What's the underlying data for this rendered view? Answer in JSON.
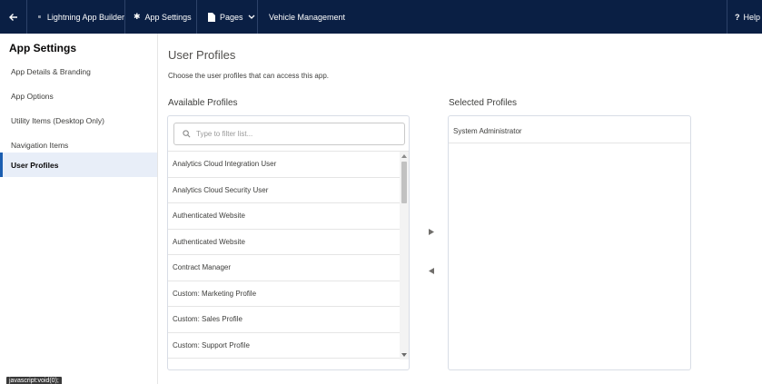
{
  "topbar": {
    "back_icon": "arrow-left-icon",
    "builder_label": "Lightning App Builder",
    "settings_label": "App Settings",
    "pages_label": "Pages",
    "app_name": "Vehicle Management",
    "help_label": "Help",
    "background_color": "#0a1f44"
  },
  "sidebar": {
    "title": "App Settings",
    "items": [
      {
        "label": "App Details & Branding",
        "active": false
      },
      {
        "label": "App Options",
        "active": false
      },
      {
        "label": "Utility Items (Desktop Only)",
        "active": false
      },
      {
        "label": "Navigation Items",
        "active": false
      },
      {
        "label": "User Profiles",
        "active": true
      }
    ]
  },
  "main": {
    "title": "User Profiles",
    "description": "Choose the user profiles that can access this app.",
    "available_label": "Available Profiles",
    "selected_label": "Selected Profiles",
    "search_placeholder": "Type to filter list...",
    "available_profiles": [
      "Analytics Cloud Integration User",
      "Analytics Cloud Security User",
      "Authenticated Website",
      "Authenticated Website",
      "Contract Manager",
      "Custom: Marketing Profile",
      "Custom: Sales Profile",
      "Custom: Support Profile"
    ],
    "selected_profiles": [
      "System Administrator"
    ]
  },
  "status_tooltip": "javascript:void(0);"
}
